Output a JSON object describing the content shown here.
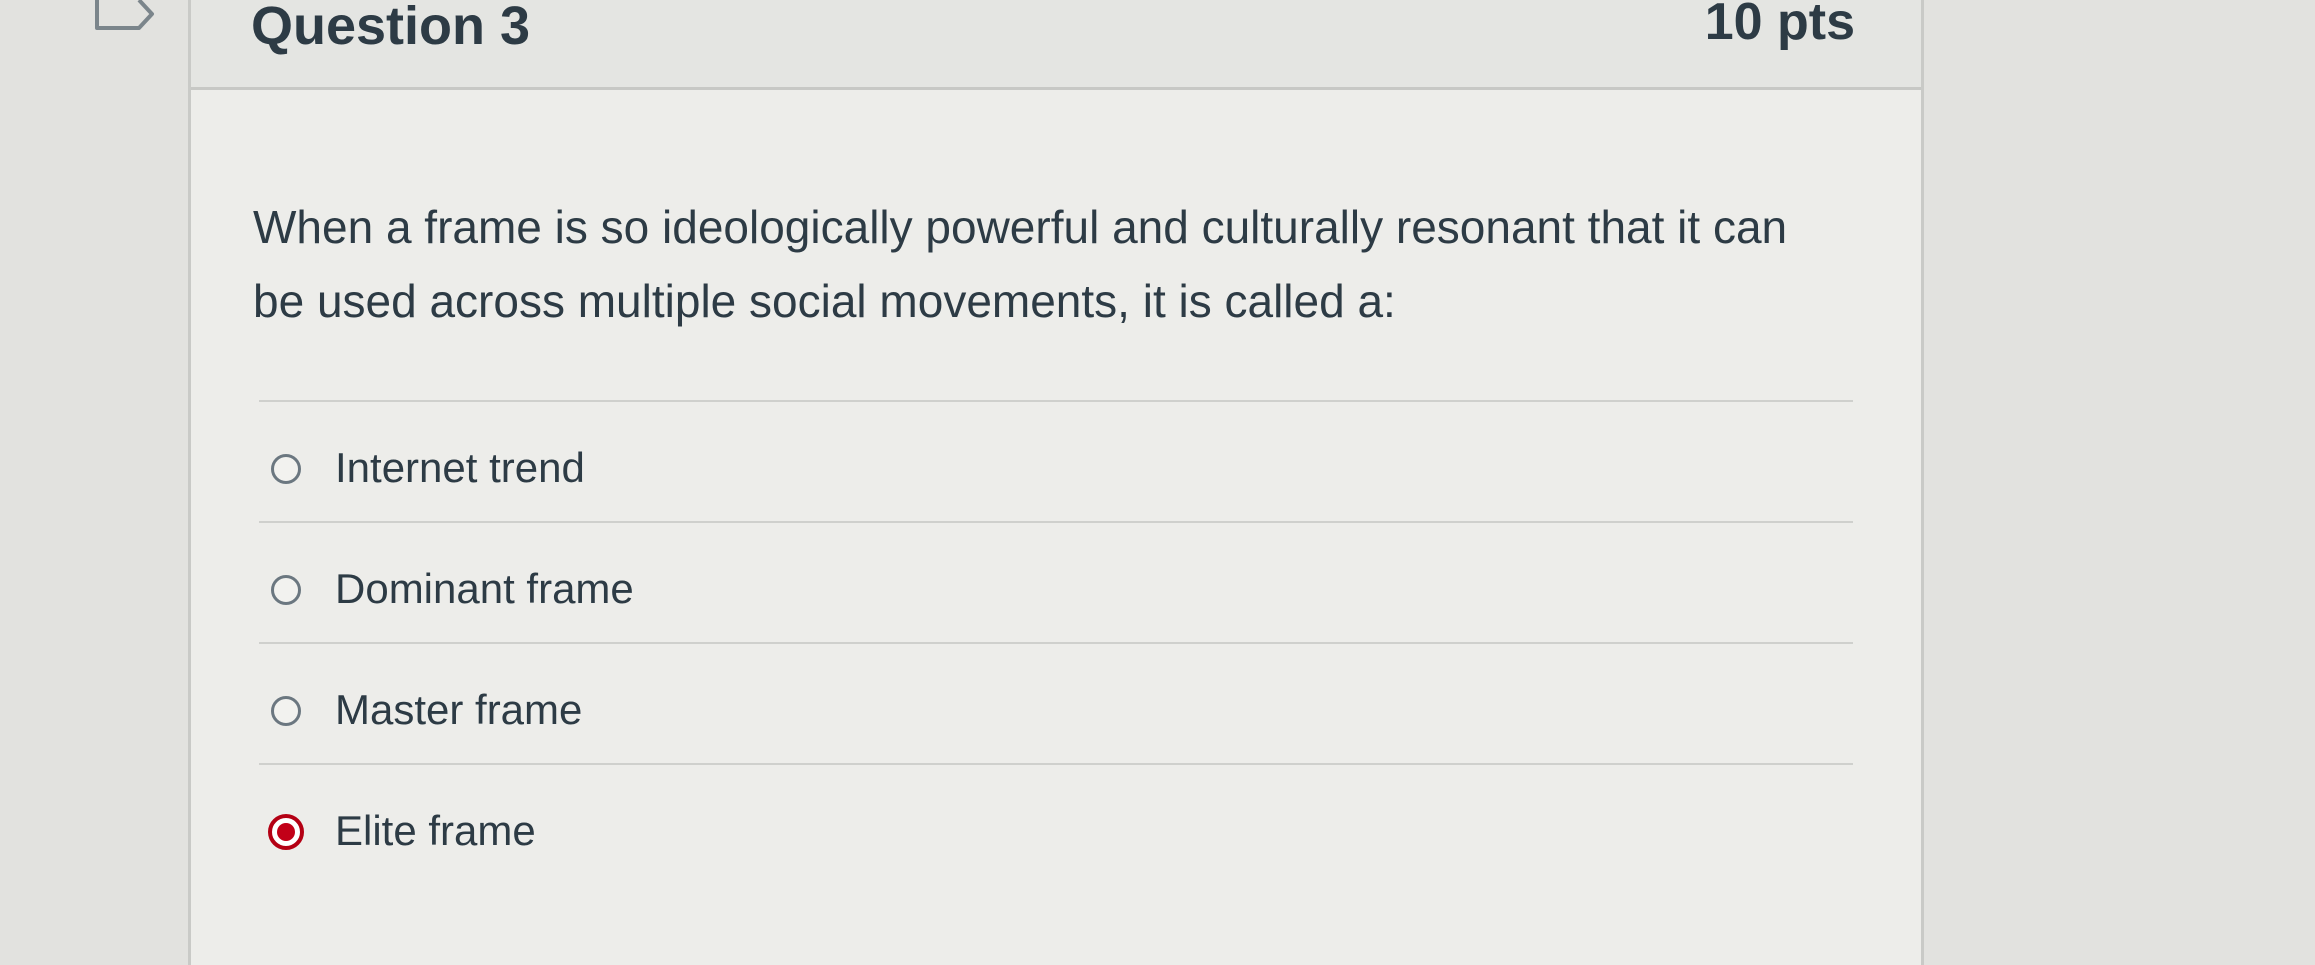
{
  "question": {
    "title": "Question 3",
    "points": "10 pts",
    "text": "When a frame is so ideologically powerful and culturally resonant that it can be used across multiple social movements, it is called a:",
    "answers": [
      {
        "label": "Internet trend",
        "selected": false
      },
      {
        "label": "Dominant frame",
        "selected": false
      },
      {
        "label": "Master frame",
        "selected": false
      },
      {
        "label": "Elite frame",
        "selected": true
      }
    ]
  },
  "colors": {
    "page_background": "#e2e2df",
    "card_background": "#ededea",
    "text": "#2d3b45",
    "selected_radio": "#c20018"
  },
  "icons": {
    "flag": "flag-icon",
    "radio": "radio-icon"
  }
}
